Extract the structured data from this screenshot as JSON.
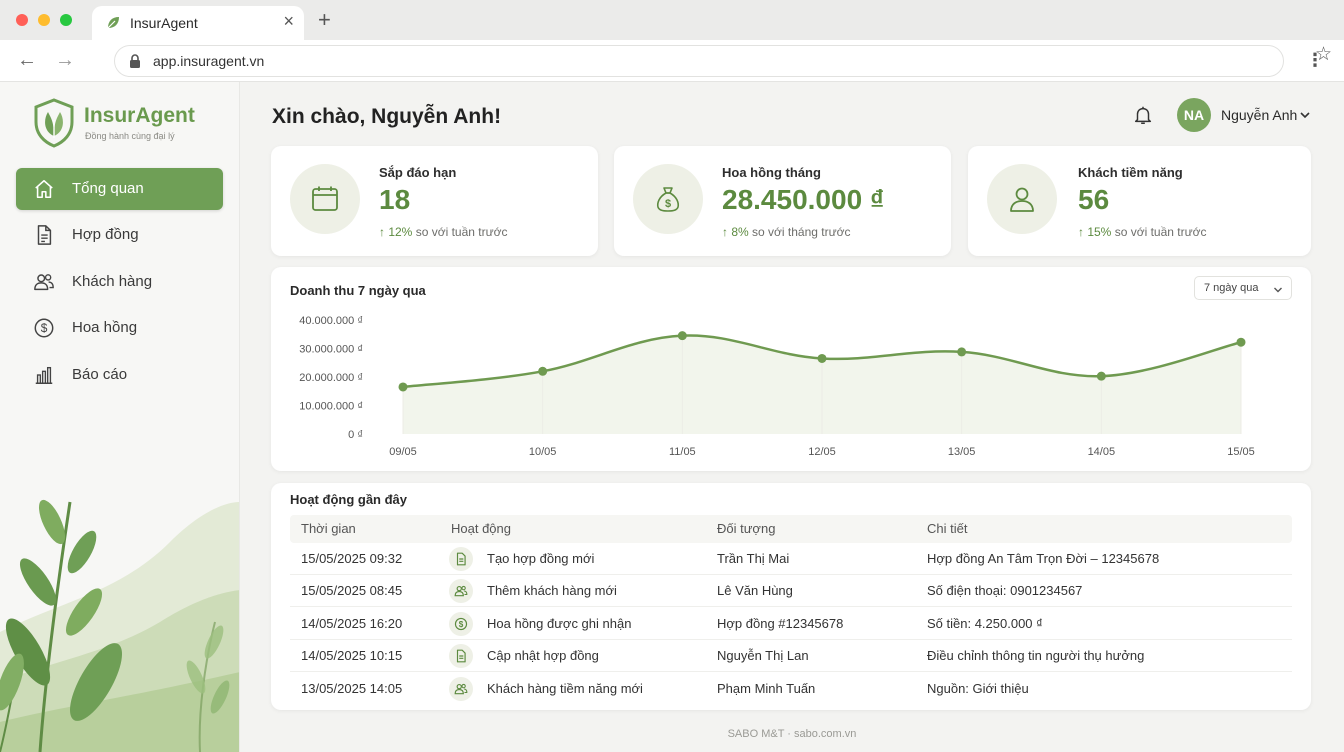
{
  "browser": {
    "tab_title": "InsurAgent",
    "url": "app.insuragent.vn",
    "icons": [
      "leaf-icon",
      "close-icon",
      "plus-icon",
      "back-icon",
      "forward-icon",
      "lock-icon",
      "star-icon",
      "kebab-icon"
    ]
  },
  "brand": {
    "name": "InsurAgent",
    "tagline": "Đồng hành cùng đại lý",
    "accent": "#6f9f56"
  },
  "sidebar": {
    "items": [
      {
        "label": "Tổng quan",
        "icon": "home-icon",
        "active": true
      },
      {
        "label": "Hợp đồng",
        "icon": "document-icon",
        "active": false
      },
      {
        "label": "Khách hàng",
        "icon": "users-icon",
        "active": false
      },
      {
        "label": "Hoa hồng",
        "icon": "dollar-icon",
        "active": false
      },
      {
        "label": "Báo cáo",
        "icon": "bar-chart-icon",
        "active": false
      }
    ]
  },
  "header": {
    "greeting": "Xin chào, Nguyễn Anh!",
    "user_initials": "NA",
    "user_name": "Nguyễn Anh"
  },
  "stats": [
    {
      "label": "Sắp đáo hạn",
      "value": "18",
      "delta_pct": "↑ 12%",
      "delta_text": " so với tuần trước",
      "icon": "calendar-icon"
    },
    {
      "label": "Hoa hồng tháng",
      "value": "28.450.000 ₫",
      "delta_pct": "↑ 8%",
      "delta_text": " so với tháng trước",
      "icon": "money-bag-icon"
    },
    {
      "label": "Khách tiềm năng",
      "value": "56",
      "delta_pct": "↑ 15%",
      "delta_text": " so với tuần trước",
      "icon": "user-icon"
    }
  ],
  "revenue": {
    "title": "Doanh thu 7 ngày qua",
    "range_label": "7 ngày qua"
  },
  "chart_data": {
    "type": "area",
    "title": "Doanh thu 7 ngày qua",
    "categories": [
      "09/05",
      "10/05",
      "11/05",
      "12/05",
      "13/05",
      "14/05",
      "15/05"
    ],
    "values": [
      16500000,
      22000000,
      34500000,
      26500000,
      28800000,
      20300000,
      32200000
    ],
    "ylim": [
      0,
      40000000
    ],
    "yticks": [
      0,
      10000000,
      20000000,
      30000000,
      40000000
    ],
    "ytick_labels": [
      "0 ₫",
      "10.000.000 ₫",
      "20.000.000 ₫",
      "30.000.000 ₫",
      "40.000.000 ₫"
    ],
    "grid": false,
    "color": "#6f9a50"
  },
  "activity": {
    "title": "Hoạt động gần đây",
    "columns": [
      "Thời gian",
      "Hoạt động",
      "Đối tượng",
      "Chi tiết"
    ],
    "rows": [
      {
        "time": "15/05/2025 09:32",
        "action": "Tạo hợp đồng mới",
        "target": "Trần Thị Mai",
        "detail": "Hợp đồng An Tâm Trọn Đời – 12345678",
        "icon": "document-icon"
      },
      {
        "time": "15/05/2025 08:45",
        "action": "Thêm khách hàng mới",
        "target": "Lê Văn Hùng",
        "detail": "Số điện thoại: 0901234567",
        "icon": "users-icon"
      },
      {
        "time": "14/05/2025 16:20",
        "action": "Hoa hồng được ghi nhận",
        "target": "Hợp đồng #12345678",
        "detail": "Số tiền: 4.250.000 ₫",
        "icon": "dollar-icon"
      },
      {
        "time": "14/05/2025 10:15",
        "action": "Cập nhật hợp đồng",
        "target": "Nguyễn Thị Lan",
        "detail": "Điều chỉnh thông tin người thụ hưởng",
        "icon": "document-icon"
      },
      {
        "time": "13/05/2025 14:05",
        "action": "Khách hàng tiềm năng mới",
        "target": "Phạm Minh Tuấn",
        "detail": "Nguồn: Giới thiệu",
        "icon": "users-icon"
      }
    ]
  },
  "footer": {
    "text": "SABO M&T · sabo.com.vn"
  }
}
